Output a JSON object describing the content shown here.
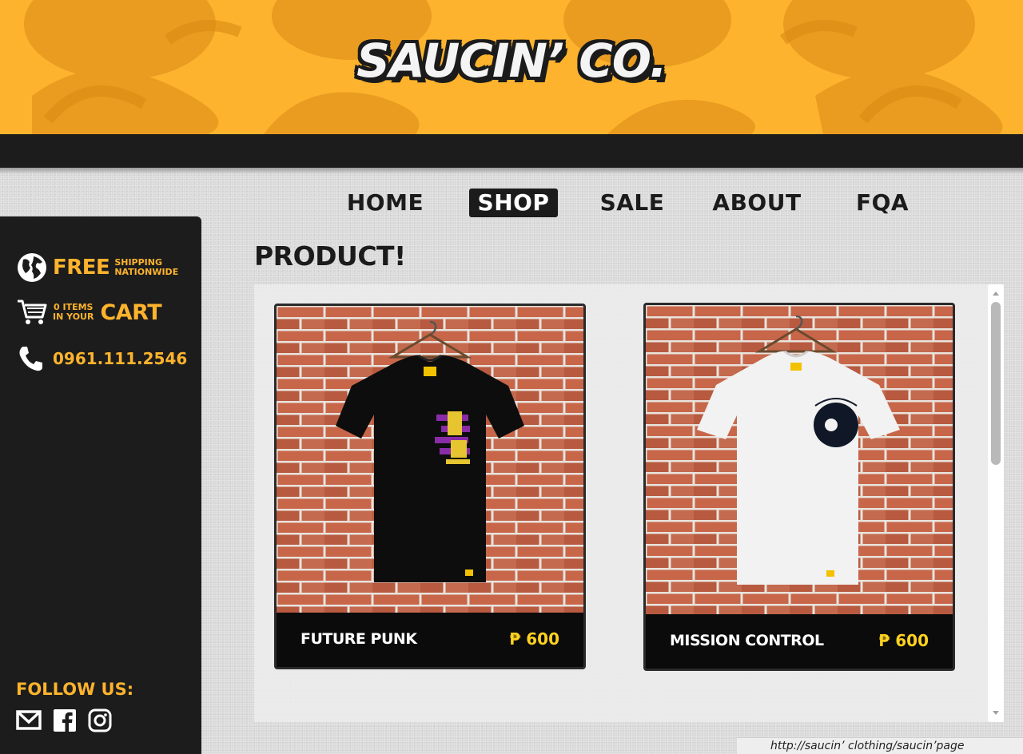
{
  "brand": {
    "logo_text": "SAUCIN’ CO."
  },
  "nav": {
    "items": [
      {
        "label": "HOME",
        "active": false
      },
      {
        "label": "SHOP",
        "active": true
      },
      {
        "label": "SALE",
        "active": false
      },
      {
        "label": "ABOUT",
        "active": false
      },
      {
        "label": "FQA",
        "active": false
      }
    ]
  },
  "sidebar": {
    "shipping": {
      "big": "FREE",
      "line1": "SHIPPING",
      "line2": "NATIONWIDE",
      "icon": "globe-icon"
    },
    "cart": {
      "line1": "0 ITEMS",
      "line2": "IN YOUR",
      "big": "CART",
      "icon": "cart-icon"
    },
    "phone": {
      "number": "0961.111.2546",
      "icon": "phone-icon"
    },
    "follow": {
      "label": "FOLLOW US:",
      "icons": [
        "mail-icon",
        "facebook-icon",
        "instagram-icon"
      ]
    }
  },
  "main": {
    "heading": "PRODUCT!",
    "products": [
      {
        "name": "FUTURE PUNK",
        "price": "₱ 600",
        "shirt_color": "#0d0d0d"
      },
      {
        "name": "MISSION CONTROL",
        "price": "₱ 600",
        "shirt_color": "#f2f2f2"
      }
    ]
  },
  "status_bar": {
    "url": "http://saucin’ clothing/saucin’page"
  },
  "colors": {
    "accent": "#fdb32d",
    "dark": "#1c1c1c",
    "price": "#ffd21f"
  }
}
